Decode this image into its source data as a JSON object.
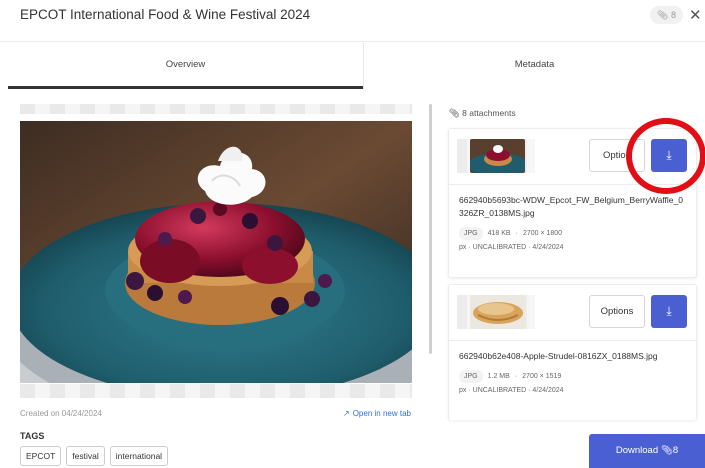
{
  "header": {
    "title": "EPCOT International Food & Wine Festival 2024",
    "count_badge": "8",
    "close_glyph": "✕"
  },
  "tabs": [
    {
      "label": "Overview",
      "active": true
    },
    {
      "label": "Metadata",
      "active": false
    }
  ],
  "preview": {
    "created": "Created on 04/24/2024",
    "open_link": "Open in new tab"
  },
  "tags": {
    "label": "TAGS",
    "items": [
      "EPCOT",
      "festival",
      "international"
    ]
  },
  "attachments": {
    "count_label": "8 attachments",
    "items": [
      {
        "filename": "662940b5693bc-WDW_Epcot_FW_Belgium_BerryWaffle_0326ZR_0138MS.jpg",
        "format": "JPG",
        "size": "418 KB",
        "dimensions": "2700 × 1800",
        "unit": "px",
        "calibration": "UNCALIBRATED",
        "date": "4/24/2024",
        "options_label": "Option"
      },
      {
        "filename": "662940b62e408-Apple-Strudel-0816ZX_0188MS.jpg",
        "format": "JPG",
        "size": "1.2 MB",
        "dimensions": "2700 × 1519",
        "unit": "px",
        "calibration": "UNCALIBRATED",
        "date": "4/24/2024",
        "options_label": "Options"
      }
    ]
  },
  "footer": {
    "download_label": "Download",
    "download_count": "8"
  },
  "colors": {
    "accent": "#4a5fd1",
    "highlight_circle": "#e20e16",
    "link": "#2f6fd6"
  },
  "icons": [
    "attachment-icon",
    "close-icon",
    "download-icon",
    "external-link-icon"
  ]
}
